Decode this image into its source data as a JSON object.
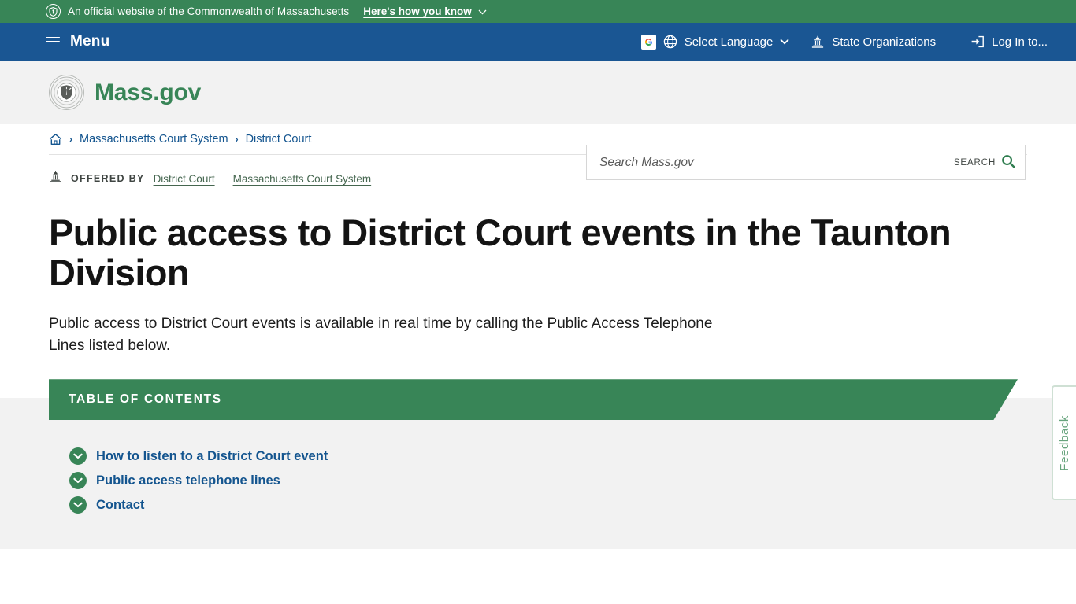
{
  "official_bar": {
    "seal_icon": "shield-seal-icon",
    "text": "An official website of the Commonwealth of Massachusetts",
    "how_you_know": "Here's how you know",
    "chevron_icon": "chevron-down-icon",
    "bg_color": "#388557"
  },
  "nav": {
    "menu_icon": "hamburger-icon",
    "menu_label": "Menu",
    "bg_color": "#1a5693",
    "items": [
      {
        "label": "Select Language",
        "icon": "globe-icon",
        "badge_icon": "google-translate-icon",
        "chevron": "chevron-down-icon"
      },
      {
        "label": "State Organizations",
        "icon": "capitol-building-icon"
      },
      {
        "label": "Log In to...",
        "icon": "login-arrow-icon"
      }
    ]
  },
  "masthead": {
    "seal_icon": "massachusetts-state-seal-icon",
    "logo_text": "Mass.gov",
    "logo_color": "#388557",
    "search": {
      "placeholder": "Search Mass.gov",
      "value": "",
      "button_label": "SEARCH",
      "button_icon": "magnifier-icon"
    }
  },
  "breadcrumb": {
    "home_icon": "home-icon",
    "separator": "›",
    "items": [
      {
        "label": "Massachusetts Court System"
      },
      {
        "label": "District Court"
      }
    ]
  },
  "offered_by": {
    "icon": "capitol-building-icon",
    "label": "OFFERED BY",
    "links": [
      {
        "label": "District Court"
      },
      {
        "label": "Massachusetts Court System"
      }
    ]
  },
  "page": {
    "title": "Public access to District Court events in the Taunton Division",
    "subtitle": "Public access to District Court events is available in real time by calling the Public Access Telephone Lines listed below."
  },
  "toc": {
    "heading": "TABLE OF CONTENTS",
    "bg_color": "#388557",
    "items": [
      {
        "label": "How to listen to a District Court event",
        "icon": "chevron-down-circle-icon"
      },
      {
        "label": "Public access telephone lines",
        "icon": "chevron-down-circle-icon"
      },
      {
        "label": "Contact",
        "icon": "chevron-down-circle-icon"
      }
    ]
  },
  "feedback": {
    "label": "Feedback",
    "color": "#66a37c"
  }
}
